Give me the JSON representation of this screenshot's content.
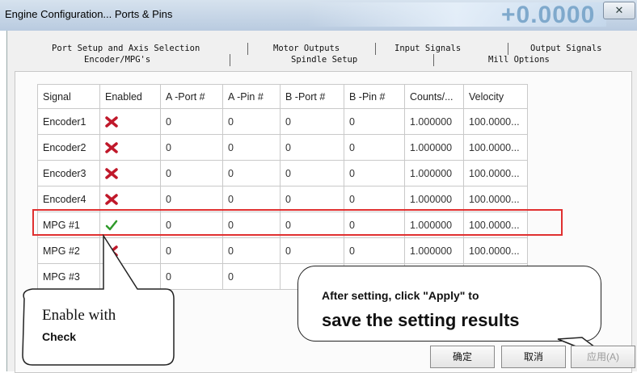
{
  "window": {
    "title": "Engine Configuration... Ports & Pins",
    "title_value": "+0.0000",
    "close_glyph": "✕"
  },
  "tabs": {
    "row1": [
      "Port Setup and Axis Selection",
      "Motor Outputs",
      "Input Signals",
      "Output Signals"
    ],
    "row2": [
      "Encoder/MPG's",
      "Spindle Setup",
      "Mill Options"
    ]
  },
  "table": {
    "headers": [
      "Signal",
      "Enabled",
      "A -Port #",
      "A -Pin #",
      "B -Port #",
      "B -Pin #",
      "Counts/...",
      "Velocity"
    ],
    "rows": [
      {
        "signal": "Encoder1",
        "enabled": "red-x-icon",
        "a_port": "0",
        "a_pin": "0",
        "b_port": "0",
        "b_pin": "0",
        "counts": "1.000000",
        "velocity": "100.0000..."
      },
      {
        "signal": "Encoder2",
        "enabled": "red-x-icon",
        "a_port": "0",
        "a_pin": "0",
        "b_port": "0",
        "b_pin": "0",
        "counts": "1.000000",
        "velocity": "100.0000..."
      },
      {
        "signal": "Encoder3",
        "enabled": "red-x-icon",
        "a_port": "0",
        "a_pin": "0",
        "b_port": "0",
        "b_pin": "0",
        "counts": "1.000000",
        "velocity": "100.0000..."
      },
      {
        "signal": "Encoder4",
        "enabled": "red-x-icon",
        "a_port": "0",
        "a_pin": "0",
        "b_port": "0",
        "b_pin": "0",
        "counts": "1.000000",
        "velocity": "100.0000..."
      },
      {
        "signal": "MPG #1",
        "enabled": "green-check-icon",
        "a_port": "0",
        "a_pin": "0",
        "b_port": "0",
        "b_pin": "0",
        "counts": "1.000000",
        "velocity": "100.0000..."
      },
      {
        "signal": "MPG #2",
        "enabled": "red-x-icon",
        "a_port": "0",
        "a_pin": "0",
        "b_port": "0",
        "b_pin": "0",
        "counts": "1.000000",
        "velocity": "100.0000..."
      },
      {
        "signal": "MPG #3",
        "enabled": "",
        "a_port": "0",
        "a_pin": "0",
        "b_port": "",
        "b_pin": "",
        "counts": "",
        "velocity": ""
      }
    ]
  },
  "annotations": {
    "left_line1": "Enable with",
    "left_line2": "Check",
    "right_line1": "After setting, click \"Apply\" to",
    "right_line2": "save the setting results"
  },
  "buttons": {
    "ok": "确定",
    "cancel": "取消",
    "apply": "应用(A)"
  },
  "colors": {
    "highlight": "#e03030",
    "disabled_icon": "#c0182a",
    "enabled_icon": "#2f9a2a"
  }
}
